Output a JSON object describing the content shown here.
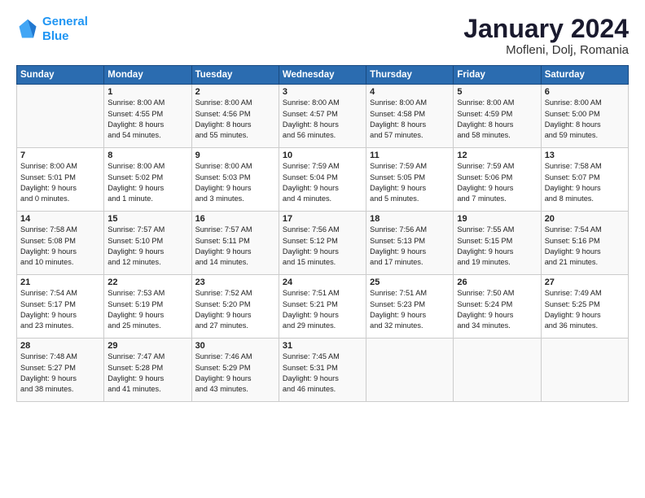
{
  "header": {
    "logo_line1": "General",
    "logo_line2": "Blue",
    "title": "January 2024",
    "location": "Mofleni, Dolj, Romania"
  },
  "weekdays": [
    "Sunday",
    "Monday",
    "Tuesday",
    "Wednesday",
    "Thursday",
    "Friday",
    "Saturday"
  ],
  "weeks": [
    [
      {
        "day": "",
        "info": ""
      },
      {
        "day": "1",
        "info": "Sunrise: 8:00 AM\nSunset: 4:55 PM\nDaylight: 8 hours\nand 54 minutes."
      },
      {
        "day": "2",
        "info": "Sunrise: 8:00 AM\nSunset: 4:56 PM\nDaylight: 8 hours\nand 55 minutes."
      },
      {
        "day": "3",
        "info": "Sunrise: 8:00 AM\nSunset: 4:57 PM\nDaylight: 8 hours\nand 56 minutes."
      },
      {
        "day": "4",
        "info": "Sunrise: 8:00 AM\nSunset: 4:58 PM\nDaylight: 8 hours\nand 57 minutes."
      },
      {
        "day": "5",
        "info": "Sunrise: 8:00 AM\nSunset: 4:59 PM\nDaylight: 8 hours\nand 58 minutes."
      },
      {
        "day": "6",
        "info": "Sunrise: 8:00 AM\nSunset: 5:00 PM\nDaylight: 8 hours\nand 59 minutes."
      }
    ],
    [
      {
        "day": "7",
        "info": "Sunrise: 8:00 AM\nSunset: 5:01 PM\nDaylight: 9 hours\nand 0 minutes."
      },
      {
        "day": "8",
        "info": "Sunrise: 8:00 AM\nSunset: 5:02 PM\nDaylight: 9 hours\nand 1 minute."
      },
      {
        "day": "9",
        "info": "Sunrise: 8:00 AM\nSunset: 5:03 PM\nDaylight: 9 hours\nand 3 minutes."
      },
      {
        "day": "10",
        "info": "Sunrise: 7:59 AM\nSunset: 5:04 PM\nDaylight: 9 hours\nand 4 minutes."
      },
      {
        "day": "11",
        "info": "Sunrise: 7:59 AM\nSunset: 5:05 PM\nDaylight: 9 hours\nand 5 minutes."
      },
      {
        "day": "12",
        "info": "Sunrise: 7:59 AM\nSunset: 5:06 PM\nDaylight: 9 hours\nand 7 minutes."
      },
      {
        "day": "13",
        "info": "Sunrise: 7:58 AM\nSunset: 5:07 PM\nDaylight: 9 hours\nand 8 minutes."
      }
    ],
    [
      {
        "day": "14",
        "info": "Sunrise: 7:58 AM\nSunset: 5:08 PM\nDaylight: 9 hours\nand 10 minutes."
      },
      {
        "day": "15",
        "info": "Sunrise: 7:57 AM\nSunset: 5:10 PM\nDaylight: 9 hours\nand 12 minutes."
      },
      {
        "day": "16",
        "info": "Sunrise: 7:57 AM\nSunset: 5:11 PM\nDaylight: 9 hours\nand 14 minutes."
      },
      {
        "day": "17",
        "info": "Sunrise: 7:56 AM\nSunset: 5:12 PM\nDaylight: 9 hours\nand 15 minutes."
      },
      {
        "day": "18",
        "info": "Sunrise: 7:56 AM\nSunset: 5:13 PM\nDaylight: 9 hours\nand 17 minutes."
      },
      {
        "day": "19",
        "info": "Sunrise: 7:55 AM\nSunset: 5:15 PM\nDaylight: 9 hours\nand 19 minutes."
      },
      {
        "day": "20",
        "info": "Sunrise: 7:54 AM\nSunset: 5:16 PM\nDaylight: 9 hours\nand 21 minutes."
      }
    ],
    [
      {
        "day": "21",
        "info": "Sunrise: 7:54 AM\nSunset: 5:17 PM\nDaylight: 9 hours\nand 23 minutes."
      },
      {
        "day": "22",
        "info": "Sunrise: 7:53 AM\nSunset: 5:19 PM\nDaylight: 9 hours\nand 25 minutes."
      },
      {
        "day": "23",
        "info": "Sunrise: 7:52 AM\nSunset: 5:20 PM\nDaylight: 9 hours\nand 27 minutes."
      },
      {
        "day": "24",
        "info": "Sunrise: 7:51 AM\nSunset: 5:21 PM\nDaylight: 9 hours\nand 29 minutes."
      },
      {
        "day": "25",
        "info": "Sunrise: 7:51 AM\nSunset: 5:23 PM\nDaylight: 9 hours\nand 32 minutes."
      },
      {
        "day": "26",
        "info": "Sunrise: 7:50 AM\nSunset: 5:24 PM\nDaylight: 9 hours\nand 34 minutes."
      },
      {
        "day": "27",
        "info": "Sunrise: 7:49 AM\nSunset: 5:25 PM\nDaylight: 9 hours\nand 36 minutes."
      }
    ],
    [
      {
        "day": "28",
        "info": "Sunrise: 7:48 AM\nSunset: 5:27 PM\nDaylight: 9 hours\nand 38 minutes."
      },
      {
        "day": "29",
        "info": "Sunrise: 7:47 AM\nSunset: 5:28 PM\nDaylight: 9 hours\nand 41 minutes."
      },
      {
        "day": "30",
        "info": "Sunrise: 7:46 AM\nSunset: 5:29 PM\nDaylight: 9 hours\nand 43 minutes."
      },
      {
        "day": "31",
        "info": "Sunrise: 7:45 AM\nSunset: 5:31 PM\nDaylight: 9 hours\nand 46 minutes."
      },
      {
        "day": "",
        "info": ""
      },
      {
        "day": "",
        "info": ""
      },
      {
        "day": "",
        "info": ""
      }
    ]
  ]
}
